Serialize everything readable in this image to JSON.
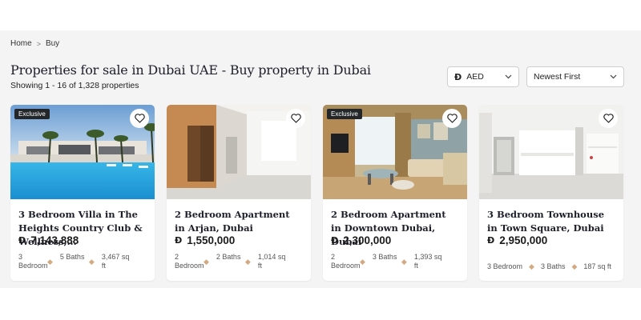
{
  "breadcrumb": {
    "home": "Home",
    "separator": ">",
    "current": "Buy"
  },
  "page_title": "Properties for sale in Dubai UAE - Buy property in Dubai",
  "results_summary": "Showing 1 - 16 of 1,328 properties",
  "currency_select": {
    "symbol": "Đ",
    "value": "AED"
  },
  "sort_select": {
    "value": "Newest First"
  },
  "listings": [
    {
      "badge": "Exclusive",
      "title": "3 Bedroom Villa in The Heights Country Club & Wellness,...",
      "price": "7,143,888",
      "bedrooms": "3 Bedroom",
      "baths": "5 Baths",
      "area": "3,467 sq ft"
    },
    {
      "badge": "",
      "title": "2 Bedroom Apartment in Arjan, Dubai",
      "price": "1,550,000",
      "bedrooms": "2 Bedroom",
      "baths": "2 Baths",
      "area": "1,014 sq ft"
    },
    {
      "badge": "Exclusive",
      "title": "2 Bedroom Apartment in Downtown Dubai, Dubai",
      "price": "2,300,000",
      "bedrooms": "2 Bedroom",
      "baths": "3 Baths",
      "area": "1,393 sq ft"
    },
    {
      "badge": "",
      "title": "3 Bedroom Townhouse in Town Square, Dubai",
      "price": "2,950,000",
      "bedrooms": "3 Bedroom",
      "baths": "3 Baths",
      "area": "187 sq ft"
    }
  ],
  "icons": {
    "favorite": "heart-icon",
    "dropdown": "chevron-down-icon",
    "currency": "dirham-icon"
  },
  "colors": {
    "accent_dot": "#d3a982",
    "badge_bg": "#23272a"
  }
}
